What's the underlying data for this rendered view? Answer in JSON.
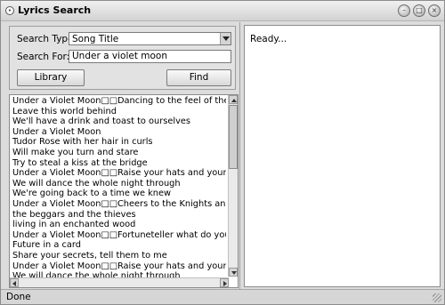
{
  "window": {
    "title": "Lyrics Search"
  },
  "search": {
    "type_label": "Search Type:",
    "type_value": "Song Title",
    "for_label": "Search For:",
    "for_value": "Under a violet moon",
    "library_button": "Library",
    "find_button": "Find"
  },
  "lyrics": [
    "Under a Violet Moon□□Dancing to the feel of the drum",
    "Leave this world behind",
    "We'll have a drink and toast to ourselves",
    "Under a Violet Moon",
    "Tudor Rose with her hair in curls",
    "Will make you turn and stare",
    "Try to steal a kiss at the bridge",
    "Under a Violet Moon□□Raise your hats and your glasses too",
    "We will dance the whole night through",
    "We're going back to a time we knew",
    "Under a Violet Moon□□Cheers to the Knights and days of old",
    "the beggars and the thieves",
    "living in an enchanted wood",
    "Under a Violet Moon□□Fortuneteller what do you see",
    "Future in a card",
    "Share your secrets, tell them to me",
    "Under a Violet Moon□□Raise your hats and your glasses too",
    "We will dance the whole night through"
  ],
  "result_panel": {
    "text": "Ready..."
  },
  "status": {
    "text": "Done"
  },
  "icons": {
    "window_icon": "app-icon",
    "minimize": "minimize-icon",
    "maximize": "maximize-icon",
    "close": "close-icon"
  }
}
